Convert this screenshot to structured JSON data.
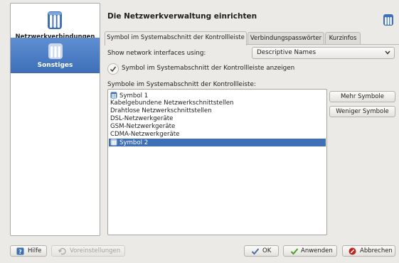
{
  "sidebar": {
    "items": [
      {
        "label": "Netzwerkverbindungen",
        "selected": false,
        "icon": "network-icon"
      },
      {
        "label": "Sonstiges",
        "selected": true,
        "icon": "network-icon"
      }
    ]
  },
  "header": {
    "title": "Die Netzwerkverwaltung einrichten",
    "icon": "network-icon"
  },
  "tabs": [
    {
      "label": "Symbol im Systemabschnitt der Kontrollleiste",
      "active": true
    },
    {
      "label": "Verbindungspasswörter",
      "active": false
    },
    {
      "label": "Kurzinfos",
      "active": false
    }
  ],
  "form": {
    "show_label": "Show network interfaces using:",
    "show_value": "Descriptive Names",
    "checkbox_label": "Symbol im Systemabschnitt der Kontrollleiste anzeigen",
    "checkbox_checked": true,
    "list_label": "Symbole im Systemabschnitt der Kontrollleiste:",
    "list_items": [
      {
        "text": "Symbol 1",
        "icon": true,
        "selected": false
      },
      {
        "text": "Kabelgebundene Netzwerkschnittstellen",
        "icon": false,
        "selected": false
      },
      {
        "text": "Drahtlose Netzwerkschnittstellen",
        "icon": false,
        "selected": false
      },
      {
        "text": "DSL-Netzwerkgeräte",
        "icon": false,
        "selected": false
      },
      {
        "text": "GSM-Netzwerkgeräte",
        "icon": false,
        "selected": false
      },
      {
        "text": "CDMA-Netzwerkgeräte",
        "icon": false,
        "selected": false
      },
      {
        "text": "Symbol 2",
        "icon": true,
        "selected": true
      }
    ],
    "more_label": "Mehr Symbole",
    "fewer_label": "Weniger Symbole"
  },
  "buttons": {
    "help": "Hilfe",
    "defaults": "Voreinstellungen",
    "ok": "OK",
    "apply": "Anwenden",
    "cancel": "Abbrechen"
  },
  "colors": {
    "accent": "#3f6fb7",
    "background": "#eceae7",
    "apply_check": "#4aa02c",
    "cancel_red": "#c0241c"
  }
}
